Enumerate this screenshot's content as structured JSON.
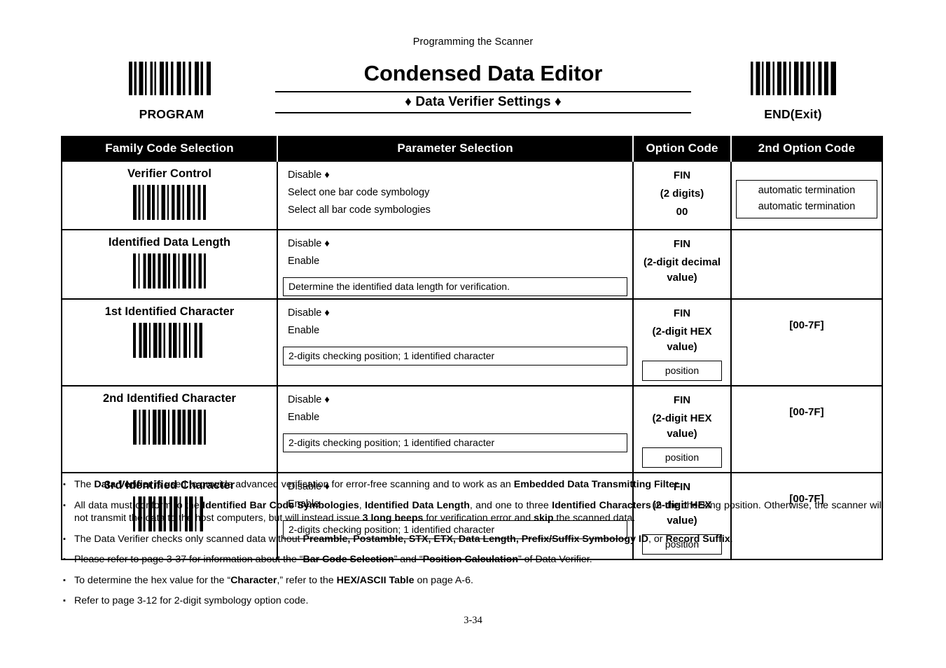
{
  "running_head": "Programming the Scanner",
  "title": "Condensed Data Editor",
  "subtitle": "♦ Data Verifier Settings ♦",
  "top_barcodes": {
    "left_label": "PROGRAM",
    "right_label": "END(Exit)"
  },
  "table": {
    "headers": {
      "family": "Family Code Selection",
      "parameter": "Parameter Selection",
      "option": "Option Code",
      "option2": "2nd Option Code"
    },
    "rows": [
      {
        "family": "Verifier Control",
        "parameters": [
          "Disable ♦",
          "Select one bar code symbology",
          "Select all bar code symbologies"
        ],
        "param_note": null,
        "option_lines": [
          "FIN",
          "(2 digits)",
          "00"
        ],
        "option_box": null,
        "option2_plain": null,
        "option2_box_lines": [
          "automatic termination",
          "automatic termination"
        ]
      },
      {
        "family": "Identified Data Length",
        "parameters": [
          "Disable ♦",
          "Enable"
        ],
        "param_note": "Determine the identified data length for verification.",
        "option_lines": [
          "FIN",
          "(2-digit decimal value)"
        ],
        "option_box": null,
        "option2_plain": null,
        "option2_box_lines": null
      },
      {
        "family": "1st Identified Character",
        "parameters": [
          "Disable ♦",
          "Enable"
        ],
        "param_note": "2-digits checking position; 1 identified character",
        "option_lines": [
          "FIN",
          "(2-digit HEX value)"
        ],
        "option_box": "position",
        "option2_plain": "[00-7F]",
        "option2_box_lines": null
      },
      {
        "family": "2nd Identified Character",
        "parameters": [
          "Disable ♦",
          "Enable"
        ],
        "param_note": "2-digits checking position; 1 identified character",
        "option_lines": [
          "FIN",
          "(2-digit HEX value)"
        ],
        "option_box": "position",
        "option2_plain": "[00-7F]",
        "option2_box_lines": null
      },
      {
        "family": "3rd Identified Character",
        "parameters": [
          "Disable ♦",
          "Enable"
        ],
        "param_note": "2-digits checking position; 1 identified character",
        "option_lines": [
          "FIN",
          "(2-digit HEX value)"
        ],
        "option_box": "position",
        "option2_plain": "[00-7F]",
        "option2_box_lines": null
      }
    ]
  },
  "notes": [
    {
      "bullet": "▪",
      "html": "The <b>Data Verifier</b> is used to provide advanced verification for error-free scanning and to work as an <b>Embedded Data Transmitting Filter</b>."
    },
    {
      "bullet": "▪",
      "html": "All data must conform to the <b>Identified Bar Code Symbologies</b>, <b>Identified Data Length</b>, and one to three <b>Identified Characters</b> in the checking position. Otherwise, the scanner will not transmit the data to the host computers, but will instead issue <b>3 long beeps</b> for verification error and <b>skip</b> the scanned data."
    },
    {
      "bullet": "▪",
      "html": "The Data Verifier checks only scanned data without <b>Preamble, Postamble, STX, ETX, Data Length, Prefix/Suffix Symbology ID</b>, or <b>Record Suffix</b>."
    },
    {
      "bullet": "▪",
      "html": "Please refer to page 3-37 for information about the “<b>Bar Code Selection</b>” and “<b>Position Calculation</b>” of Data Verifier."
    },
    {
      "bullet": "▪",
      "html": "To determine the hex value for the “<b>Character</b>,” refer to the <b>HEX/ASCII Table</b> on page A-6."
    },
    {
      "bullet": "▪",
      "html": "Refer to page 3-12 for 2-digit symbology option code."
    }
  ],
  "footer": {
    "page_number": "3-34"
  }
}
